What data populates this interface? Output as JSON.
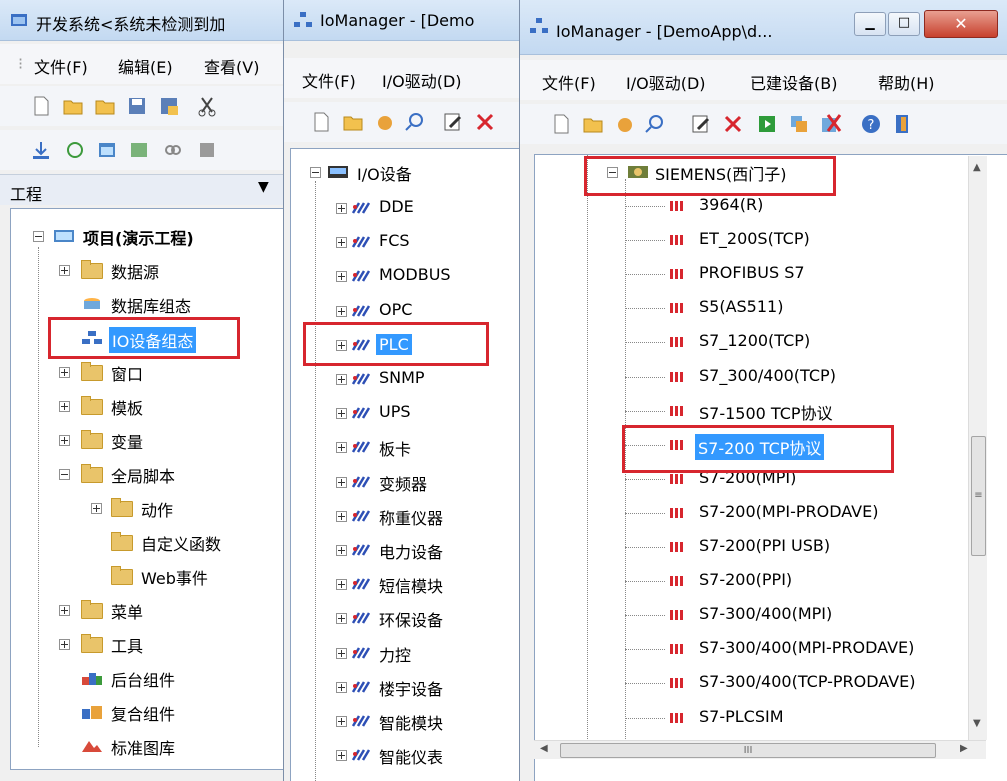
{
  "win1": {
    "title": "开发系统<系统未检测到加",
    "menu": [
      "文件(F)",
      "编辑(E)",
      "查看(V)"
    ],
    "panel_title": "工程",
    "tree": [
      {
        "label": "项目(演示工程)",
        "bold": true
      },
      {
        "label": "数据源"
      },
      {
        "label": "数据库组态"
      },
      {
        "label": "IO设备组态"
      },
      {
        "label": "窗口"
      },
      {
        "label": "模板"
      },
      {
        "label": "变量"
      },
      {
        "label": "全局脚本"
      },
      {
        "label": "动作"
      },
      {
        "label": "自定义函数"
      },
      {
        "label": "Web事件"
      },
      {
        "label": "菜单"
      },
      {
        "label": "工具"
      },
      {
        "label": "后台组件"
      },
      {
        "label": "复合组件"
      },
      {
        "label": "标准图库"
      }
    ]
  },
  "win2": {
    "title": "IoManager - [Demo",
    "menu": [
      "文件(F)",
      "I/O驱动(D)"
    ],
    "root": "I/O设备",
    "items": [
      "DDE",
      "FCS",
      "MODBUS",
      "OPC",
      "PLC",
      "SNMP",
      "UPS",
      "板卡",
      "变频器",
      "称重仪器",
      "电力设备",
      "短信模块",
      "环保设备",
      "力控",
      "楼宇设备",
      "智能模块",
      "智能仪表"
    ]
  },
  "win3": {
    "title": "IoManager - [DemoApp\\d...",
    "menu": [
      "文件(F)",
      "I/O驱动(D)",
      "已建设备(B)",
      "帮助(H)"
    ],
    "group": "SIEMENS(西门子)",
    "items": [
      "3964(R)",
      "ET_200S(TCP)",
      "PROFIBUS S7",
      "S5(AS511)",
      "S7_1200(TCP)",
      "S7_300/400(TCP)",
      "S7-1500 TCP协议",
      "S7-200 TCP协议",
      "S7-200(MPI)",
      "S7-200(MPI-PRODAVE)",
      "S7-200(PPI USB)",
      "S7-200(PPI)",
      "S7-300/400(MPI)",
      "S7-300/400(MPI-PRODAVE)",
      "S7-300/400(TCP-PRODAVE)",
      "S7-PLCSIM"
    ],
    "hscroll_label": "III"
  }
}
